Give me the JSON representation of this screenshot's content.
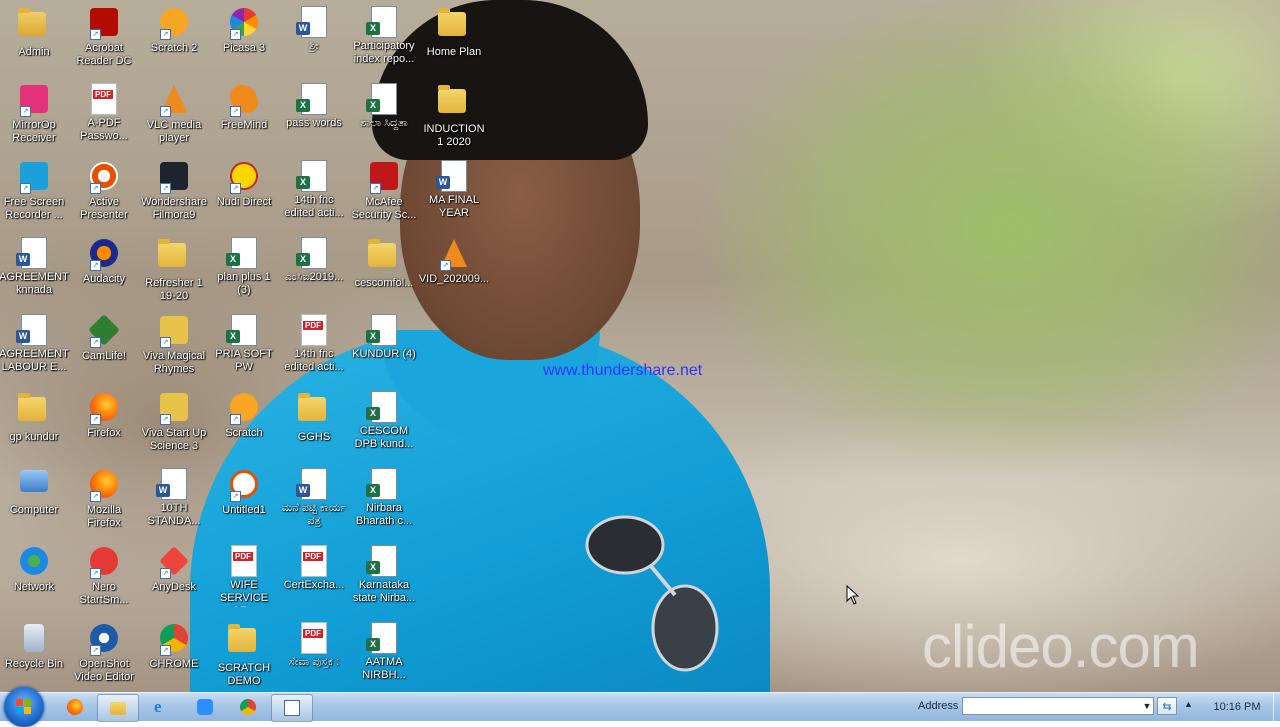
{
  "desktop": {
    "icons": [
      {
        "label": "Admin",
        "icon": "user-folder-icon"
      },
      {
        "label": "Acrobat\nReader DC",
        "icon": "acrobat-icon"
      },
      {
        "label": "Scratch 2",
        "icon": "scratch-icon"
      },
      {
        "label": "Picasa 3",
        "icon": "picasa-icon"
      },
      {
        "label": "ಶ್ರೀ",
        "icon": "word-doc-icon"
      },
      {
        "label": "Participatory\nindex repo...",
        "icon": "excel-doc-icon"
      },
      {
        "label": "Home Plan",
        "icon": "folder-icon"
      },
      {
        "label": "MirrorOp\nReceiver",
        "icon": "mirrorop-icon"
      },
      {
        "label": "A-PDF\nPasswo...",
        "icon": "pdf-icon"
      },
      {
        "label": "VLC media\nplayer",
        "icon": "vlc-icon"
      },
      {
        "label": "FreeMind",
        "icon": "freemind-icon"
      },
      {
        "label": "pass words",
        "icon": "excel-doc-icon"
      },
      {
        "label": "ಶಾಲಾ ಸಿದ್ಧತಾ",
        "icon": "excel-doc-icon"
      },
      {
        "label": "INDUCTION\n1 2020",
        "icon": "folder-icon"
      },
      {
        "label": "Free Screen\nRecorder ...",
        "icon": "screen-recorder-icon"
      },
      {
        "label": "Active\nPresenter",
        "icon": "active-presenter-icon"
      },
      {
        "label": "Wondershare\nFilmora9",
        "icon": "filmora-icon"
      },
      {
        "label": "Nudi Direct",
        "icon": "nudi-icon"
      },
      {
        "label": "14th fnc\nedited acti...",
        "icon": "excel-doc-icon"
      },
      {
        "label": "McAfee\nSecurity Sc...",
        "icon": "mcafee-icon"
      },
      {
        "label": "MA FINAL\nYEAR",
        "icon": "word-doc-icon"
      },
      {
        "label": "AGREEMENT\nknnada",
        "icon": "word-doc-icon"
      },
      {
        "label": "Audacity",
        "icon": "audacity-icon"
      },
      {
        "label": "Refresher 1\n19-20",
        "icon": "folder-icon"
      },
      {
        "label": "plan plus 1\n(3)",
        "icon": "excel-doc-icon"
      },
      {
        "label": "ಎಂಸಿಐ2019...",
        "icon": "excel-doc-icon"
      },
      {
        "label": "cescomfol...",
        "icon": "folder-icon"
      },
      {
        "label": "VID_202009...",
        "icon": "vlc-icon"
      },
      {
        "label": "AGREEMENT\nLABOUR E...",
        "icon": "word-doc-icon"
      },
      {
        "label": "CamLife!",
        "icon": "camlife-icon"
      },
      {
        "label": "Viva Magical\nRhymes",
        "icon": "viva-icon"
      },
      {
        "label": "PRIA SOFT\nPW",
        "icon": "excel-doc-icon"
      },
      {
        "label": "14th fnc\nedited acti...",
        "icon": "pdf-icon"
      },
      {
        "label": "KUNDUR (4)",
        "icon": "excel-doc-icon"
      },
      {
        "label": "",
        "icon": ""
      },
      {
        "label": "gp kundur",
        "icon": "folder-icon"
      },
      {
        "label": "Firefox",
        "icon": "firefox-icon"
      },
      {
        "label": "Viva Start Up\nScience 3",
        "icon": "viva-icon"
      },
      {
        "label": "Scratch",
        "icon": "scratch-icon"
      },
      {
        "label": "GGHS",
        "icon": "folder-icon"
      },
      {
        "label": "CESCOM\nDPB kund...",
        "icon": "excel-doc-icon"
      },
      {
        "label": "",
        "icon": ""
      },
      {
        "label": "Computer",
        "icon": "computer-icon"
      },
      {
        "label": "Mozilla\nFirefox",
        "icon": "firefox-icon"
      },
      {
        "label": "10TH\nSTANDA...",
        "icon": "word-doc-icon"
      },
      {
        "label": "Untitled1",
        "icon": "untitled-icon"
      },
      {
        "label": "ಮನೆ ಪಟ್ಟಿ ಕಾರ್ಯ\nಪತ್ರ",
        "icon": "word-doc-icon"
      },
      {
        "label": "Nirbara\nBharath c...",
        "icon": "excel-doc-icon"
      },
      {
        "label": "",
        "icon": ""
      },
      {
        "label": "Network",
        "icon": "network-icon"
      },
      {
        "label": "Nero\nStartSm...",
        "icon": "nero-icon"
      },
      {
        "label": "AnyDesk",
        "icon": "anydesk-icon"
      },
      {
        "label": "WIFE\nSERVICE CE...",
        "icon": "pdf-icon"
      },
      {
        "label": "CertExcha...",
        "icon": "pdf-icon"
      },
      {
        "label": "Karnataka\nstate Nirba...",
        "icon": "excel-doc-icon"
      },
      {
        "label": "",
        "icon": ""
      },
      {
        "label": "Recycle Bin",
        "icon": "recycle-bin-icon"
      },
      {
        "label": "OpenShot\nVideo Editor",
        "icon": "openshot-icon"
      },
      {
        "label": "CHROME",
        "icon": "chrome-icon"
      },
      {
        "label": "SCRATCH\nDEMO",
        "icon": "folder-icon"
      },
      {
        "label": "ಸೇವಾ ಪುಸ್ತಕ :",
        "icon": "pdf-icon"
      },
      {
        "label": "AATMA\nNIRBH...",
        "icon": "excel-doc-icon"
      },
      {
        "label": "",
        "icon": ""
      }
    ],
    "watermark_url": "www.thundershare.net",
    "watermark_brand": "clideo.com"
  },
  "taskbar": {
    "pinned": [
      {
        "name": "taskbar-firefox",
        "icon": "firefox-icon"
      },
      {
        "name": "taskbar-explorer",
        "icon": "folder-icon"
      },
      {
        "name": "taskbar-ie",
        "icon": "internet-explorer-icon"
      },
      {
        "name": "taskbar-zoom",
        "icon": "video-icon"
      },
      {
        "name": "taskbar-chrome",
        "icon": "chrome-icon"
      },
      {
        "name": "taskbar-app",
        "icon": "window-app-icon"
      }
    ],
    "address_label": "Address",
    "address_value": "",
    "clock": "10:16 PM"
  },
  "colors": {
    "shirt": "#129ed6",
    "taskbar": "#a7c6e6",
    "watermark_url": "#2a34ff"
  }
}
